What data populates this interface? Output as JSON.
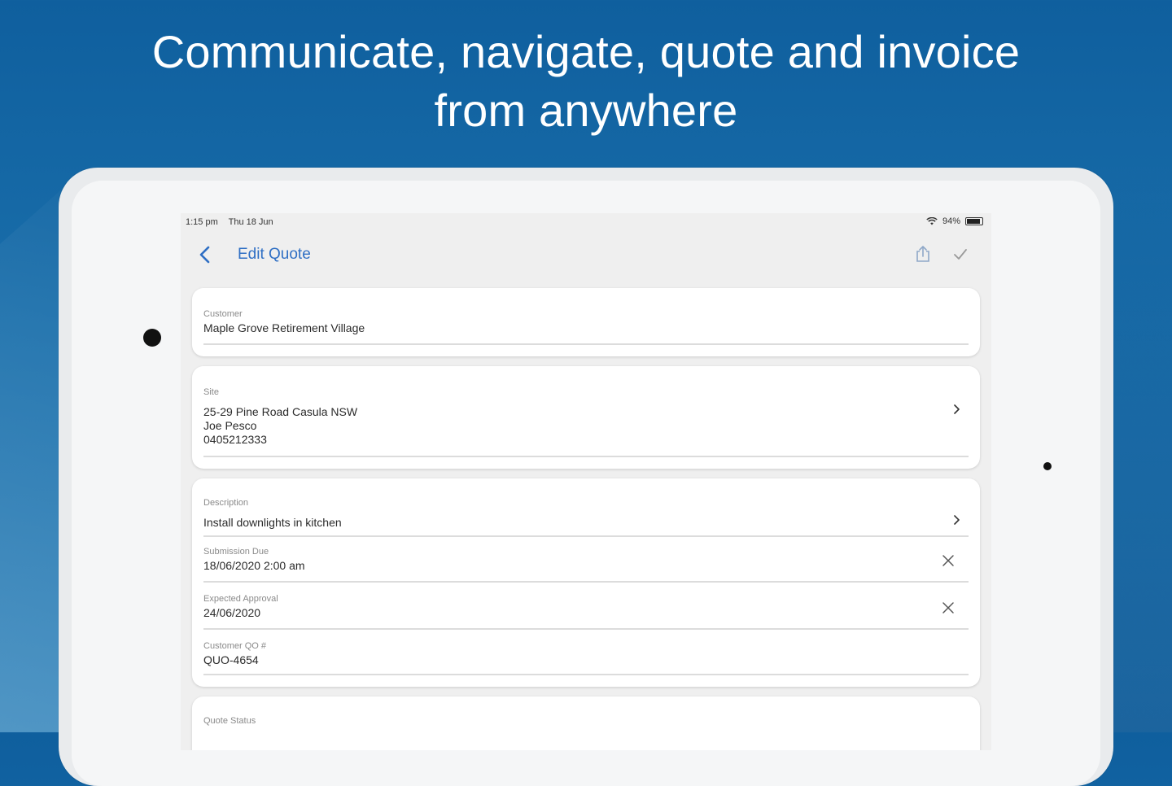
{
  "headline": {
    "line1": "Communicate, navigate, quote and invoice",
    "line2": "from anywhere"
  },
  "status_bar": {
    "time": "1:15 pm",
    "date": "Thu 18 Jun",
    "battery": "94%"
  },
  "nav": {
    "title": "Edit Quote",
    "back_icon": "chevron-left-icon",
    "share_icon": "share-icon",
    "done_icon": "checkmark-icon"
  },
  "customer": {
    "label": "Customer",
    "value": "Maple Grove Retirement Village"
  },
  "site": {
    "label": "Site",
    "address": "25-29 Pine Road Casula NSW",
    "contact": "Joe Pesco",
    "phone": "0405212333"
  },
  "details": {
    "description_label": "Description",
    "description_value": "Install downlights in kitchen",
    "submission_label": "Submission Due",
    "submission_value": "18/06/2020 2:00 am",
    "approval_label": "Expected Approval",
    "approval_value": "24/06/2020",
    "po_label": "Customer QO #",
    "po_value": "QUO-4654"
  },
  "status_card": {
    "label": "Quote Status"
  },
  "colors": {
    "accent": "#2f6fc4",
    "background": "#1a6fab"
  }
}
